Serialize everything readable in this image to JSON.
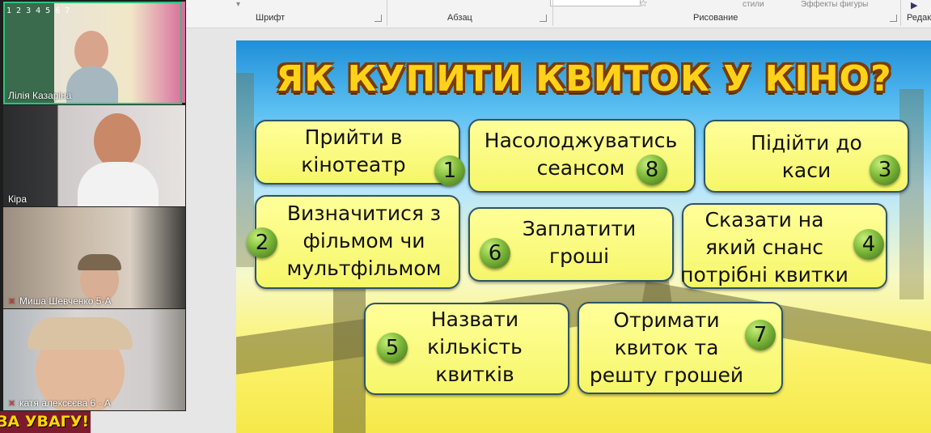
{
  "ribbon": {
    "font_group": "Шрифт",
    "paragraph_group": "Абзац",
    "drawing_group": "Рисование",
    "editing_group": "Редак",
    "styles_label": "стили",
    "effects_label": "Эффекты фигуры"
  },
  "slide": {
    "title": "ЯК КУПИТИ КВИТОК У КІНО?",
    "cards": [
      {
        "text": "Прийти в кінотеатр",
        "number": "1"
      },
      {
        "text": "Насолоджуватись сеансом",
        "number": "8"
      },
      {
        "text": "Підійти до каси",
        "number": "3"
      },
      {
        "text": "Визначитися з фільмом чи мультфільмом",
        "number": "2"
      },
      {
        "text": "Заплатити гроші",
        "number": "6"
      },
      {
        "text": "Сказати на який снанс потрібні квитки",
        "number": "4"
      },
      {
        "text": "Назвати кількість квитків",
        "number": "5"
      },
      {
        "text": "Отримати квиток та решту грошей",
        "number": "7"
      }
    ]
  },
  "participants": [
    {
      "name": "Лілія Казаріна",
      "muted": false,
      "active": true,
      "board_numbers": "1 2 3 4 5 6 7"
    },
    {
      "name": "Кіра",
      "muted": false,
      "active": false
    },
    {
      "name": "Миша Шевченко 5-А",
      "muted": true,
      "active": false
    },
    {
      "name": "катя алексєєва 6 - А",
      "muted": true,
      "active": false
    }
  ],
  "bottom_banner": "ЗА УВАГУ!",
  "colors": {
    "active_border": "#2ec27e",
    "card_border": "#2d5566",
    "title": "#ffd21a"
  }
}
